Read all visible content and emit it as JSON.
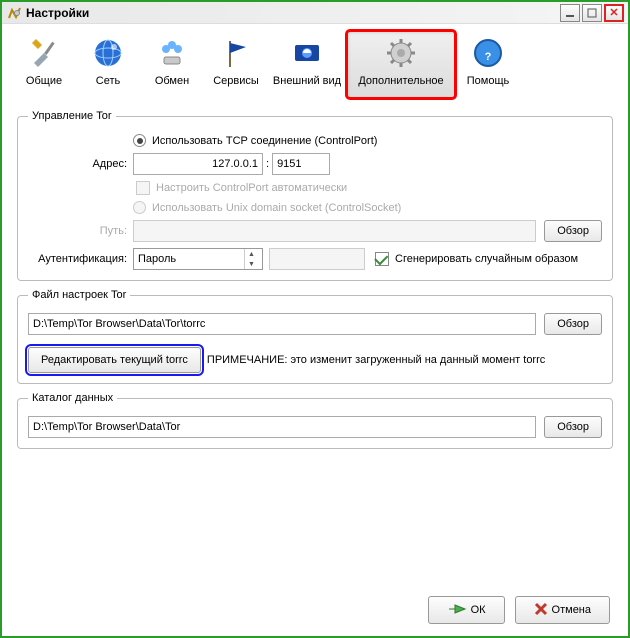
{
  "title": "Настройки",
  "toolbar": {
    "general": "Общие",
    "network": "Сеть",
    "sharing": "Обмен",
    "services": "Сервисы",
    "appearance": "Внешний вид",
    "advanced": "Дополнительное",
    "help": "Помощь"
  },
  "tor_control": {
    "legend": "Управление Tor",
    "use_tcp": "Использовать TCP соединение (ControlPort)",
    "address_label": "Адрес:",
    "ip": "127.0.0.1",
    "ip_port_sep": ":",
    "port": "9151",
    "auto_config": "Настроить ControlPort автоматически",
    "use_unix": "Использовать Unix domain socket (ControlSocket)",
    "path_label": "Путь:",
    "browse": "Обзор",
    "auth_label": "Аутентификация:",
    "auth_method": "Пароль",
    "gen_random": "Сгенерировать случайным образом"
  },
  "torrc": {
    "legend": "Файл настроек Tor",
    "path": "D:\\Temp\\Tor Browser\\Data\\Tor\\torrc",
    "browse": "Обзор",
    "edit": "Редактировать текущий torrc",
    "note": "ПРИМЕЧАНИЕ: это изменит загруженный на данный момент torrc"
  },
  "datadir": {
    "legend": "Каталог данных",
    "path": "D:\\Temp\\Tor Browser\\Data\\Tor",
    "browse": "Обзор"
  },
  "footer": {
    "ok": "ОК",
    "cancel": "Отмена"
  }
}
